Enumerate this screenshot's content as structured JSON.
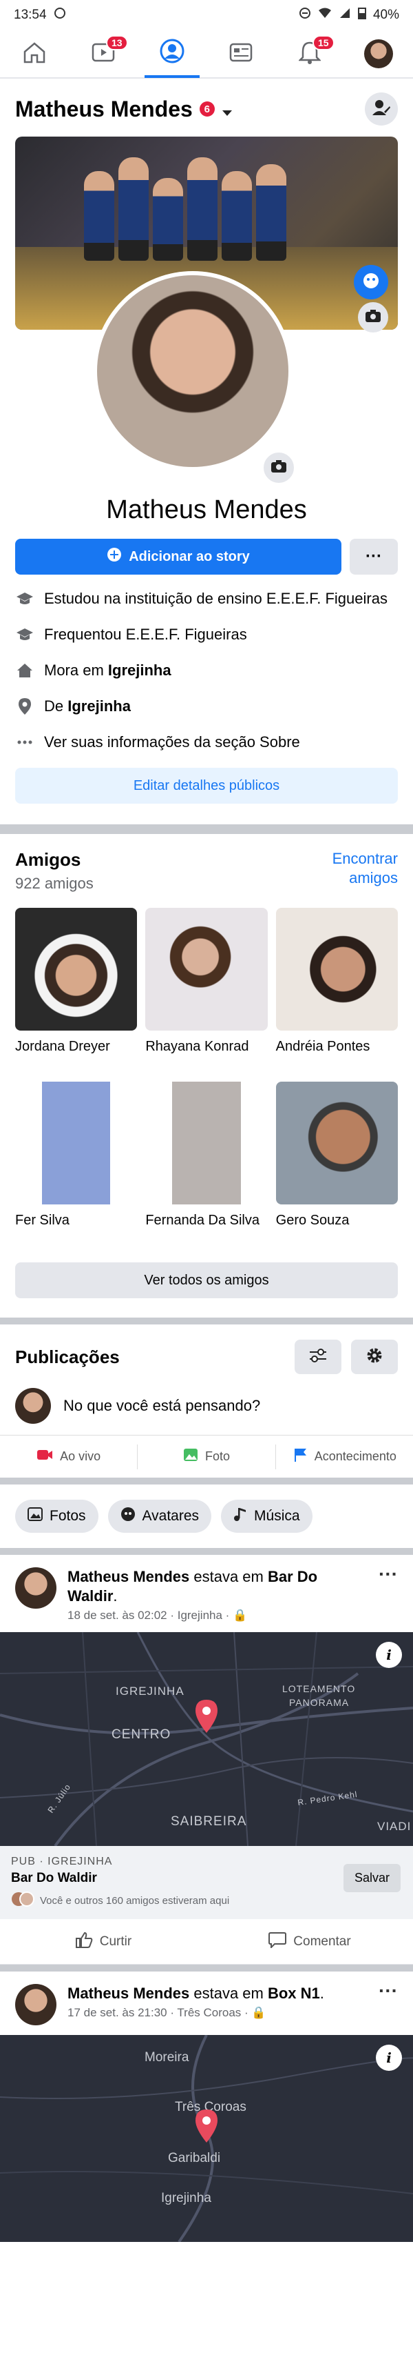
{
  "status": {
    "time": "13:54",
    "battery": "40%"
  },
  "nav": {
    "video_badge": "13",
    "bell_badge": "15"
  },
  "profile": {
    "header_name": "Matheus Mendes",
    "header_badge": "6",
    "full_name": "Matheus Mendes",
    "add_story": "Adicionar ao story",
    "more": "···"
  },
  "details": [
    {
      "icon": "graduation-cap-icon",
      "text": "Estudou na instituição de ensino E.E.E.F. Figueiras",
      "bold": ""
    },
    {
      "icon": "graduation-cap-icon",
      "text": "Frequentou E.E.E.F. Figueiras",
      "bold": ""
    },
    {
      "icon": "home-icon",
      "text": "Mora em ",
      "bold": "Igrejinha"
    },
    {
      "icon": "location-pin-icon",
      "text": "De ",
      "bold": "Igrejinha"
    },
    {
      "icon": "ellipsis-icon",
      "text": "Ver suas informações da seção Sobre",
      "bold": ""
    }
  ],
  "edit_public": "Editar detalhes públicos",
  "friends": {
    "title": "Amigos",
    "count": "922 amigos",
    "find": "Encontrar amigos",
    "list": [
      {
        "name": "Jordana Dreyer"
      },
      {
        "name": "Rhayana Konrad"
      },
      {
        "name": "Andréia Pontes"
      },
      {
        "name": "Fer Silva"
      },
      {
        "name": "Fernanda Da Silva"
      },
      {
        "name": "Gero Souza"
      }
    ],
    "see_all": "Ver todos os amigos"
  },
  "publications": {
    "title": "Publicações",
    "composer_placeholder": "No que você está pensando?",
    "live": "Ao vivo",
    "photo": "Foto",
    "event": "Acontecimento"
  },
  "chips": {
    "photos": "Fotos",
    "avatars": "Avatares",
    "music": "Música"
  },
  "post1": {
    "author": "Matheus Mendes",
    "was_at": " estava em ",
    "place": "Bar Do Waldir",
    "meta": "18 de set. às 02:02 · Igrejinha · 🔒",
    "map_labels": {
      "igrejinha": "IGREJINHA",
      "loteamento": "LOTEAMENTO",
      "panorama": "PANORAMA",
      "centro": "CENTRO",
      "saibreira": "SAIBREIRA",
      "viad": "VIADI",
      "road1": "R. Júlio",
      "road2": "R. Pedro Kehl"
    },
    "category": "PUB · IGREJINHA",
    "place_name": "Bar Do Waldir",
    "visited": "Você e outros 160 amigos estiveram aqui",
    "save": "Salvar",
    "like": "Curtir",
    "comment": "Comentar"
  },
  "post2": {
    "author": "Matheus Mendes",
    "was_at": " estava em ",
    "place": "Box N1",
    "meta": "17 de set. às 21:30 · Três Coroas · 🔒",
    "map_labels": {
      "moreira": "Moreira",
      "tres_coroas": "Três Coroas",
      "garibaldi": "Garibaldi",
      "igrejinha": "Igrejinha"
    }
  },
  "colors": {
    "accent": "#1877f2",
    "badge": "#e41e3f",
    "pin": "#e94a5d"
  }
}
